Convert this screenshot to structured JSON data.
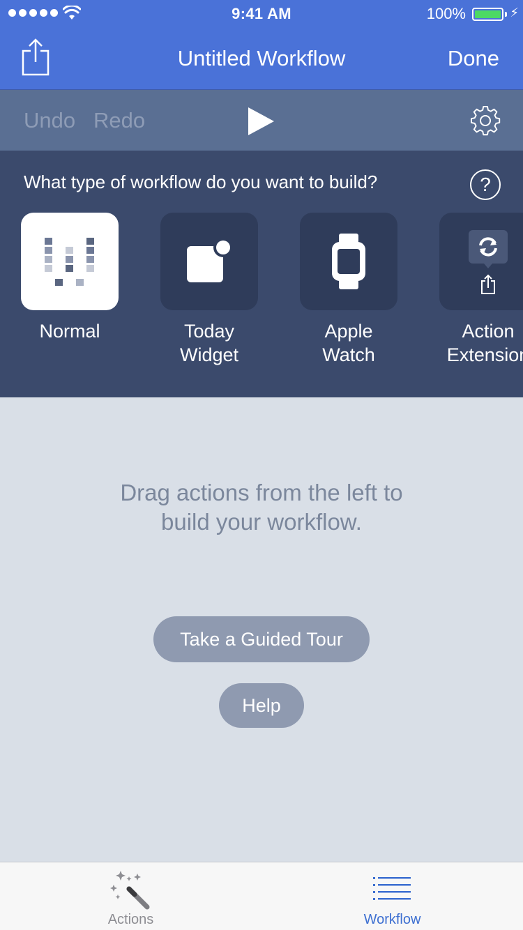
{
  "status_bar": {
    "time": "9:41 AM",
    "battery_percent": "100%",
    "battery_level": 1.0,
    "signal_bars": 5,
    "battery_color": "#4cd964"
  },
  "nav": {
    "share_icon": "share-icon",
    "title": "Untitled Workflow",
    "done_label": "Done",
    "background": "#4a72d8"
  },
  "toolbar": {
    "undo_label": "Undo",
    "redo_label": "Redo",
    "play_icon": "play-icon",
    "settings_icon": "gear-icon"
  },
  "chooser": {
    "question": "What type of workflow do you want to build?",
    "help_glyph": "?",
    "types": [
      {
        "label": "Normal",
        "icon": "normal-grid-icon",
        "selected": true
      },
      {
        "label": "Today\nWidget",
        "icon": "today-widget-icon",
        "selected": false
      },
      {
        "label": "Apple\nWatch",
        "icon": "apple-watch-icon",
        "selected": false
      },
      {
        "label": "Action\nExtension",
        "icon": "action-extension-icon",
        "selected": false
      }
    ]
  },
  "main": {
    "empty_message": "Drag actions from the left to\nbuild your workflow.",
    "tour_button": "Take a Guided Tour",
    "help_button": "Help"
  },
  "tabbar": {
    "tabs": [
      {
        "label": "Actions",
        "icon": "magic-wand-icon",
        "active": false,
        "color": "#8e8e93"
      },
      {
        "label": "Workflow",
        "icon": "list-icon",
        "active": true,
        "color": "#3d6fd1"
      }
    ]
  }
}
